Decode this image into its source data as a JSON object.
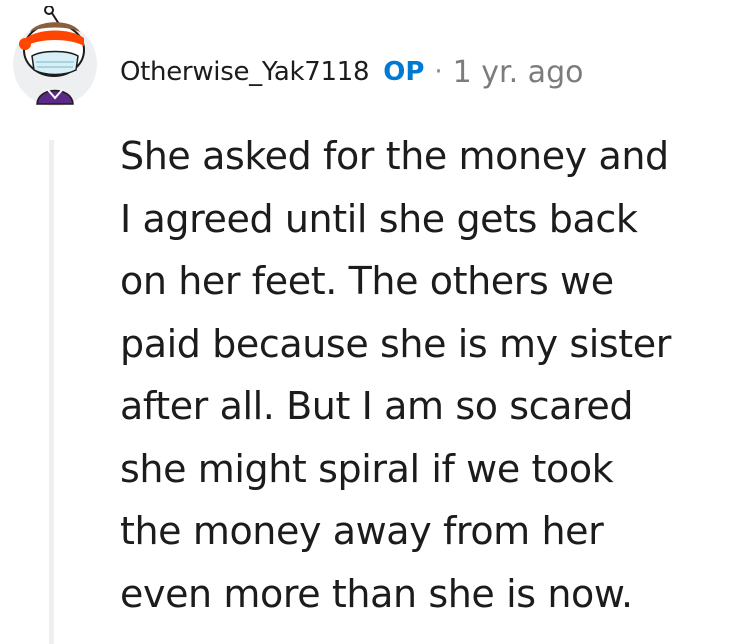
{
  "comment": {
    "author": "Otherwise_Yak7118",
    "op_label": "OP",
    "separator": "·",
    "timestamp": "1 yr. ago",
    "avatar_icon": "snoo-avatar-icon",
    "body_lines": [
      "She asked for the money and",
      "I agreed until she gets back",
      "on her feet. The others we",
      "paid because she is my sister",
      "after all. But I am so scared",
      "she might spiral if we took",
      "the money away from her",
      "even more than she is now."
    ]
  },
  "colors": {
    "op_accent": "#0079d3",
    "avatar_headband": "#ff4500",
    "thread_line": "#edeff1",
    "meta_text": "#7c7c7c"
  }
}
